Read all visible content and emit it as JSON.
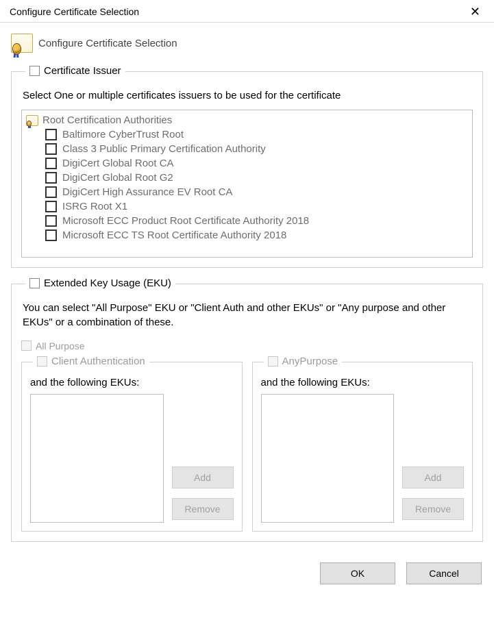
{
  "window": {
    "title": "Configure Certificate Selection"
  },
  "header": {
    "title": "Configure Certificate Selection"
  },
  "issuer_group": {
    "legend": "Certificate Issuer",
    "description": "Select One or multiple certificates issuers to be used for the certificate",
    "root_label": "Root Certification Authorities",
    "items": [
      {
        "label": "Baltimore CyberTrust Root",
        "checked": false
      },
      {
        "label": "Class 3 Public Primary Certification Authority",
        "checked": false
      },
      {
        "label": "DigiCert Global Root CA",
        "checked": false
      },
      {
        "label": "DigiCert Global Root G2",
        "checked": false
      },
      {
        "label": "DigiCert High Assurance EV Root CA",
        "checked": false
      },
      {
        "label": "ISRG Root X1",
        "checked": false
      },
      {
        "label": "Microsoft ECC Product Root Certificate Authority 2018",
        "checked": false
      },
      {
        "label": "Microsoft ECC TS Root Certificate Authority 2018",
        "checked": false
      }
    ]
  },
  "eku_group": {
    "legend": "Extended Key Usage (EKU)",
    "description": "You can select \"All Purpose\" EKU or \"Client Auth and other EKUs\" or \"Any purpose and other EKUs\" or a combination of these.",
    "all_purpose_label": "All Purpose",
    "client_auth": {
      "legend": "Client Authentication",
      "desc": "and the following EKUs:",
      "add": "Add",
      "remove": "Remove"
    },
    "any_purpose": {
      "legend": "AnyPurpose",
      "desc": "and the following EKUs:",
      "add": "Add",
      "remove": "Remove"
    }
  },
  "footer": {
    "ok": "OK",
    "cancel": "Cancel"
  }
}
